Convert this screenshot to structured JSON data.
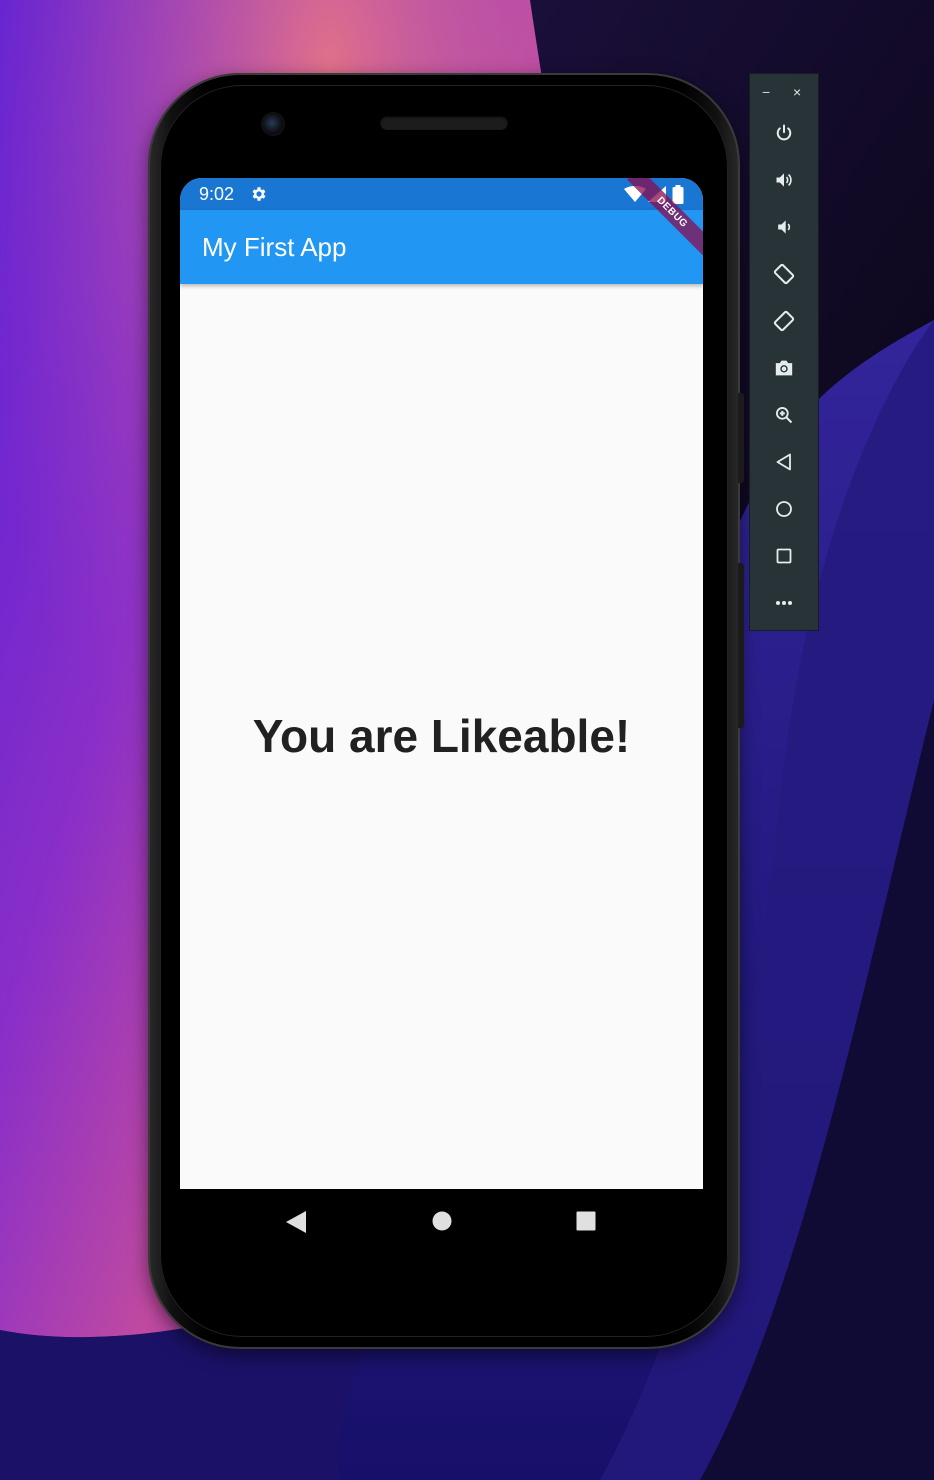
{
  "status_bar": {
    "time": "9:02",
    "icons": [
      "settings-icon",
      "wifi-icon",
      "signal-icon",
      "battery-icon"
    ]
  },
  "app_bar": {
    "title": "My First App"
  },
  "debug_banner": {
    "label": "DEBUG"
  },
  "body": {
    "message": "You are Likeable!"
  },
  "nav_bar": {
    "icons": [
      "back-icon",
      "home-icon",
      "recents-icon"
    ]
  },
  "emulator_toolbar": {
    "minimize_label": "−",
    "close_label": "×",
    "buttons": [
      "power-icon",
      "volume-up-icon",
      "volume-down-icon",
      "rotate-left-icon",
      "rotate-right-icon",
      "camera-icon",
      "zoom-icon",
      "back-icon",
      "home-icon",
      "overview-icon",
      "more-icon"
    ]
  },
  "colors": {
    "status_bar": "#1976d2",
    "app_bar": "#2196f3",
    "screen_background": "#fafafa",
    "debug_banner": "#880e4f",
    "toolbar_background": "#283337"
  }
}
